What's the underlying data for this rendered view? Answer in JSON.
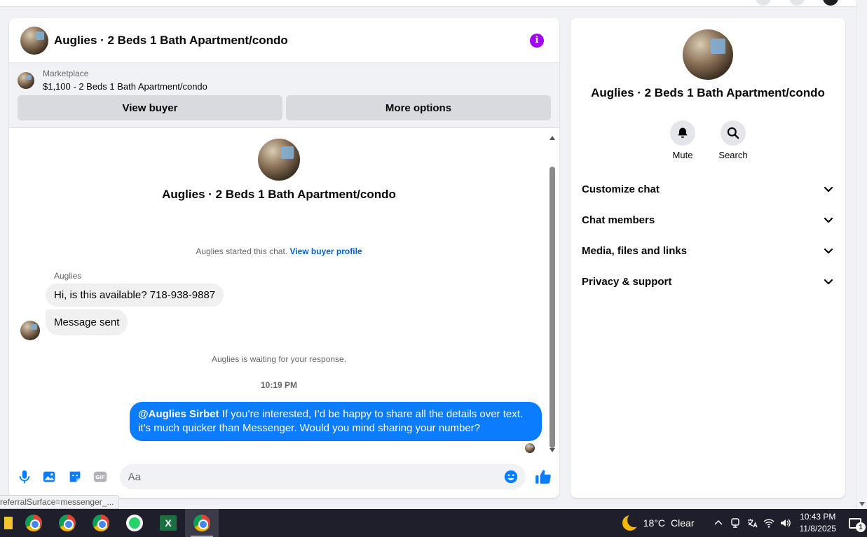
{
  "chat": {
    "title": "Auglies · 2 Beds 1 Bath Apartment/condo",
    "info_icon": "info-icon",
    "marketplace": {
      "label": "Marketplace",
      "listing": "$1,100 - 2 Beds 1 Bath Apartment/condo",
      "view_buyer": "View buyer",
      "more_options": "More options"
    },
    "intro_title": "Auglies · 2 Beds 1 Bath Apartment/condo",
    "started_text": "Auglies started this chat.",
    "view_buyer_profile": "View buyer profile",
    "sender_name": "Auglies",
    "incoming": [
      "Hi, is this available? 718-938-9887",
      "Message sent"
    ],
    "waiting_text": "Auglies is waiting for your response.",
    "timestamp": "10:19 PM",
    "outgoing": {
      "mention": "@Auglies Sirbet",
      "text": " If you’re interested, I’d be happy to share all the details over text. it’s much quicker than Messenger. Would you mind sharing your number?"
    },
    "composer": {
      "placeholder": "Aa",
      "icons": [
        "microphone-icon",
        "photo-icon",
        "sticker-icon",
        "gif-icon",
        "emoji-icon",
        "like-icon"
      ]
    }
  },
  "status_url": "referralSurface=messenger_...",
  "info_panel": {
    "title": "Auglies · 2 Beds 1 Bath Apartment/condo",
    "actions": [
      {
        "label": "Mute",
        "icon": "bell-icon"
      },
      {
        "label": "Search",
        "icon": "search-icon"
      }
    ],
    "sections": [
      {
        "label": "Customize chat"
      },
      {
        "label": "Chat members"
      },
      {
        "label": "Media, files and links"
      },
      {
        "label": "Privacy & support"
      }
    ]
  },
  "taskbar": {
    "apps": [
      "file-explorer-icon",
      "chrome-icon",
      "chrome-icon",
      "chrome-icon",
      "whatsapp-icon",
      "excel-icon",
      "chrome-icon"
    ],
    "weather": {
      "temp": "18°C",
      "condition": "Clear"
    },
    "clock": {
      "time": "10:43 PM",
      "date": "11/8/2025"
    },
    "notification_count": "1"
  },
  "colors": {
    "accent_blue": "#0a7cff",
    "link_blue": "#0064d1",
    "info_purple": "#a100ff",
    "taskbar": "#1f1f2b"
  }
}
